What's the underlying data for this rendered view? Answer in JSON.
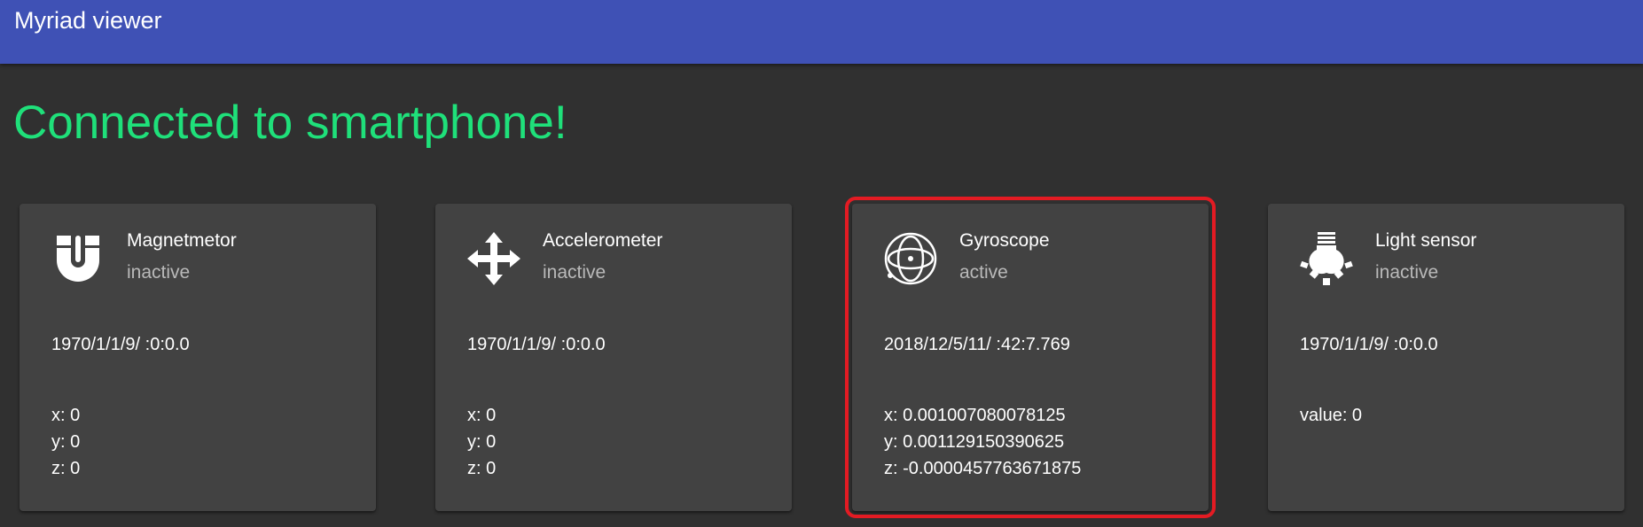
{
  "appbar": {
    "title": "Myriad viewer",
    "color": "#3f51b5"
  },
  "status": {
    "text": "Connected to smartphone!",
    "color": "#1fe07a"
  },
  "cards": [
    {
      "title": "Magnetmetor",
      "status": "inactive",
      "icon": "magnet-icon",
      "timestamp": "1970/1/1/9/ :0:0.0",
      "values": [
        "x: 0",
        "y: 0",
        "z: 0"
      ]
    },
    {
      "title": "Accelerometer",
      "status": "inactive",
      "icon": "move-arrows-icon",
      "timestamp": "1970/1/1/9/ :0:0.0",
      "values": [
        "x: 0",
        "y: 0",
        "z: 0"
      ]
    },
    {
      "title": "Gyroscope",
      "status": "active",
      "icon": "gyroscope-icon",
      "timestamp": "2018/12/5/11/ :42:7.769",
      "values": [
        "x: 0.001007080078125",
        "y: 0.001129150390625",
        "z: -0.0000457763671875"
      ],
      "highlighted": true,
      "highlight_color": "#e31b23"
    },
    {
      "title": "Light sensor",
      "status": "inactive",
      "icon": "light-bulb-icon",
      "timestamp": "1970/1/1/9/ :0:0.0",
      "values": [
        "value: 0"
      ]
    }
  ]
}
